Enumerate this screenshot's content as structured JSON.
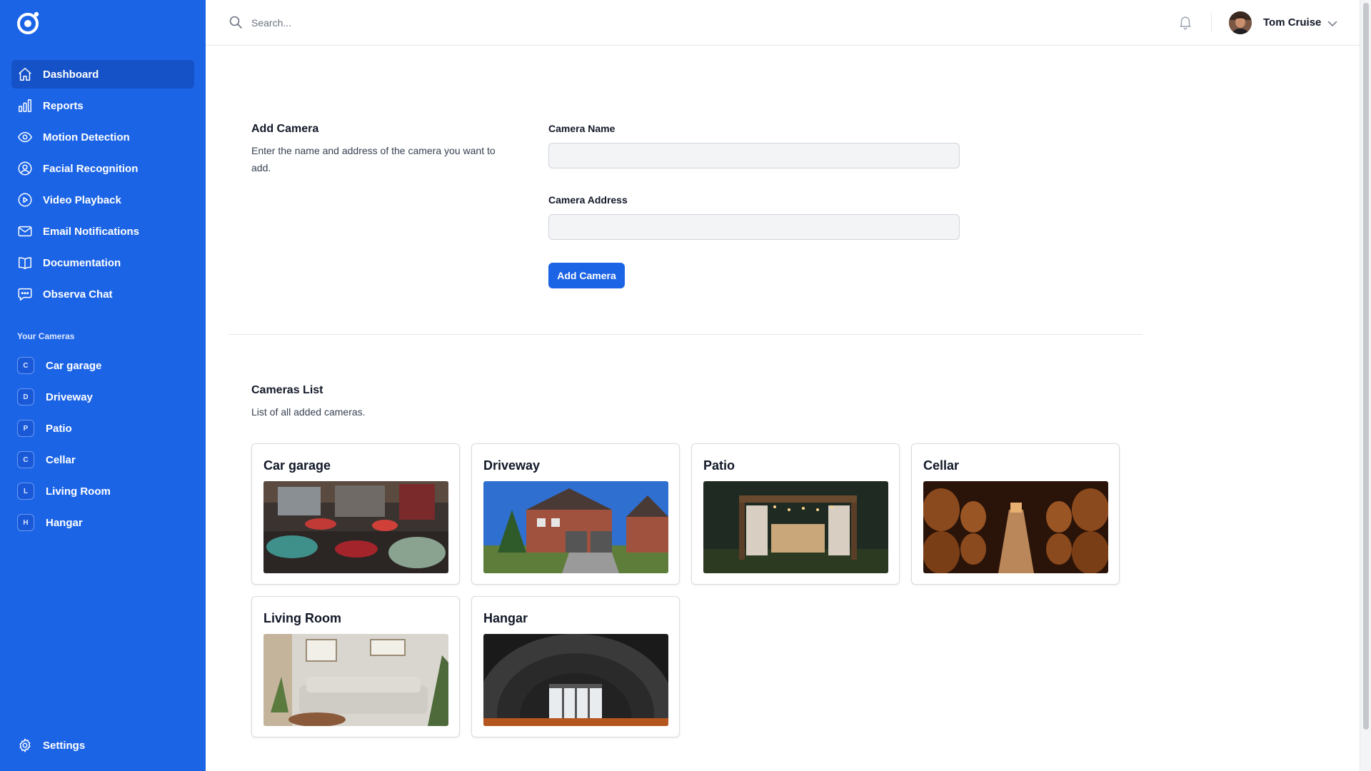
{
  "app": {
    "logo_icon": "observa-eye-logo-icon",
    "brand_color": "#1c64e6"
  },
  "sidebar": {
    "nav": [
      {
        "label": "Dashboard",
        "icon": "home-icon",
        "active": true
      },
      {
        "label": "Reports",
        "icon": "bar-chart-icon"
      },
      {
        "label": "Motion Detection",
        "icon": "eye-icon"
      },
      {
        "label": "Facial Recognition",
        "icon": "user-circle-icon"
      },
      {
        "label": "Video Playback",
        "icon": "play-circle-icon"
      },
      {
        "label": "Email Notifications",
        "icon": "envelope-icon"
      },
      {
        "label": "Documentation",
        "icon": "book-icon"
      },
      {
        "label": "Observa Chat",
        "icon": "chat-bubble-icon"
      }
    ],
    "cameras_heading": "Your Cameras",
    "cameras": [
      {
        "initial": "C",
        "label": "Car garage"
      },
      {
        "initial": "D",
        "label": "Driveway"
      },
      {
        "initial": "P",
        "label": "Patio"
      },
      {
        "initial": "C",
        "label": "Cellar"
      },
      {
        "initial": "L",
        "label": "Living Room"
      },
      {
        "initial": "H",
        "label": "Hangar"
      }
    ],
    "settings_label": "Settings"
  },
  "topbar": {
    "search_placeholder": "Search...",
    "user_name": "Tom Cruise"
  },
  "add_camera": {
    "title": "Add Camera",
    "description": "Enter the name and address of the camera you want to add.",
    "name_label": "Camera Name",
    "name_value": "",
    "address_label": "Camera Address",
    "address_value": "",
    "button_label": "Add Camera"
  },
  "cameras_list": {
    "title": "Cameras List",
    "description": "List of all added cameras.",
    "cards": [
      {
        "title": "Car garage",
        "image": "car-garage-photo"
      },
      {
        "title": "Driveway",
        "image": "driveway-house-photo"
      },
      {
        "title": "Patio",
        "image": "patio-gazebo-photo"
      },
      {
        "title": "Cellar",
        "image": "wine-cellar-photo"
      },
      {
        "title": "Living Room",
        "image": "living-room-photo"
      },
      {
        "title": "Hangar",
        "image": "hangar-tunnel-photo"
      }
    ]
  }
}
